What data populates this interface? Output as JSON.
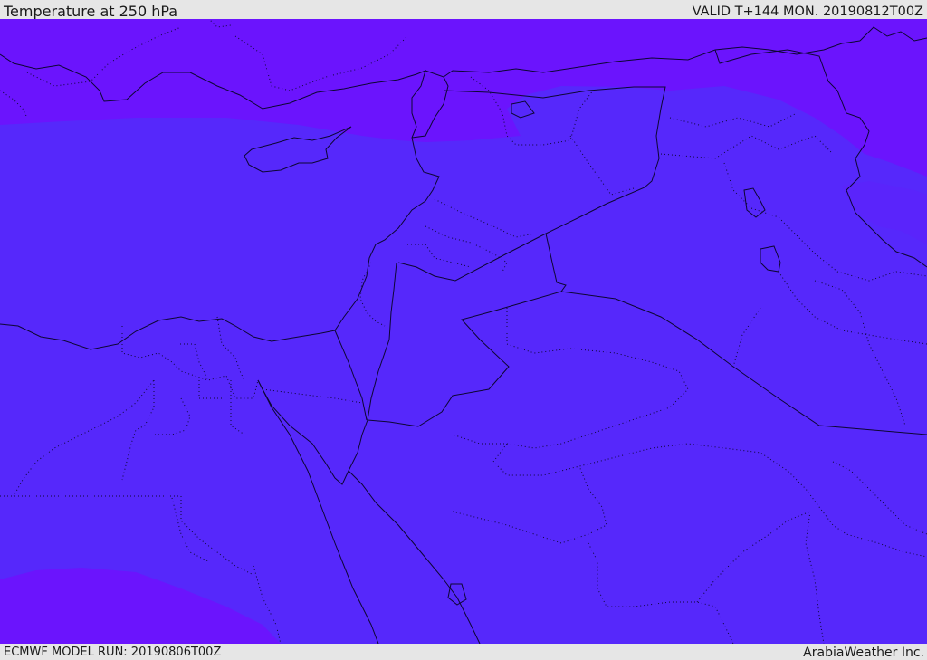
{
  "header": {
    "title": "Temperature at 250 hPa",
    "valid": "VALID T+144 MON. 20190812T00Z"
  },
  "footer": {
    "model_run": "ECMWF MODEL RUN: 20190806T00Z",
    "brand": "ArabiaWeather Inc."
  },
  "map": {
    "colors": {
      "base_fill": "#5628fb",
      "warm_band": "#6b14fd",
      "border": "#0d0633"
    }
  }
}
